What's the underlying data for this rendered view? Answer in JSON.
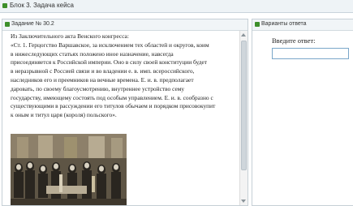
{
  "window": {
    "title": "Блок 3. Задача кейса"
  },
  "task_panel": {
    "title": "Задание № 30.2",
    "text_lines": [
      "Из Заключительного акта Венского конгресса:",
      "«Ст. 1. Герцогство Варшавское, за исключением тех областей и округов, коим",
      "в нижеследующих статьях положено иное назначение, навсегда",
      "присоединяется к Российской империи. Оно в силу своей конституции будет",
      "в неразрывной с Россией связи и во владении е. в. имп. всероссийского,",
      "наследников его и преемников на вечные времена. Е. и. в. предполагает",
      "даровать, по своему благоусмотрению, внутреннее устройство сему",
      "государству, имеющему состоять под особым управлением. Е. и. в. сообразно с",
      "существующими в рассуждении его титулов обычаем и порядком присовокупит",
      "к оным и титул царя (короля) польского»."
    ]
  },
  "answer_panel": {
    "title": "Варианты ответа",
    "prompt": "Введите ответ:",
    "input_value": ""
  },
  "colors": {
    "header_bg": "#eef3f6",
    "border": "#c6d0d6",
    "icon": "#3d8f2a",
    "input_border": "#7aa7c9"
  }
}
